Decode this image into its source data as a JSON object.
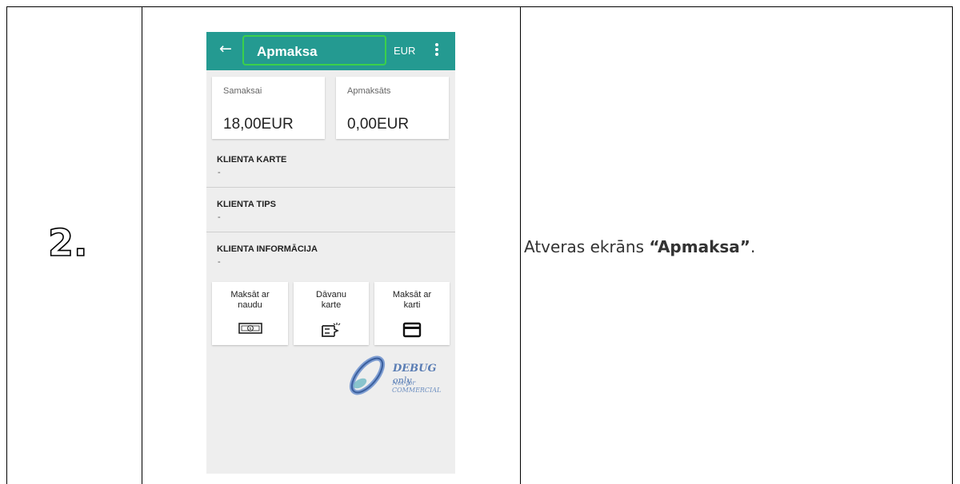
{
  "step": {
    "number": "2."
  },
  "description": {
    "prefix": "Atveras ekrāns ",
    "emphasis": "“Apmaksa”",
    "suffix": "."
  },
  "appbar": {
    "title": "Apmaksa",
    "currency": "EUR",
    "title_highlight_color": "#3bd04a",
    "bar_color": "#249a91"
  },
  "summary": {
    "due_label": "Samaksai",
    "due_value": "18,00EUR",
    "paid_label": "Apmaksāts",
    "paid_value": "0,00EUR"
  },
  "client": {
    "card_label": "KLIENTA KARTE",
    "card_value": "-",
    "type_label": "KLIENTA TIPS",
    "type_value": "-",
    "info_label": "KLIENTA INFORMĀCIJA",
    "info_value": "-"
  },
  "payment_methods": [
    {
      "label": "Maksāt ar\nnaudu",
      "icon": "cash-icon"
    },
    {
      "label": "Dāvanu\nkarte",
      "icon": "gift-card-icon"
    },
    {
      "label": "Maksāt ar\nkarti",
      "icon": "credit-card-icon"
    }
  ],
  "watermark": {
    "line1": "DEBUG",
    "line1b": "only",
    "line2": "Not for COMMERCIAL"
  }
}
